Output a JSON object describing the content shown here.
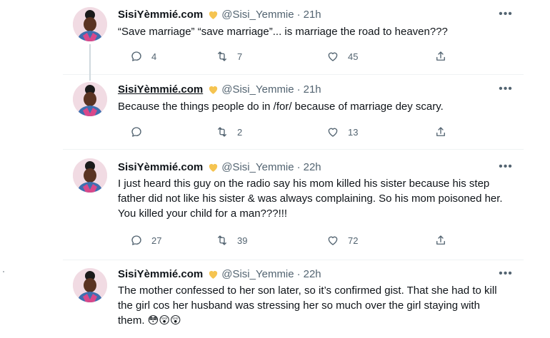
{
  "tweets": [
    {
      "name": "SisiYèmmié.com",
      "handle": "@Sisi_Yemmie",
      "sep": "·",
      "time": "21h",
      "text": "“Save marriage” “save marriage”... is marriage the road to heaven???",
      "replies": "4",
      "retweets": "7",
      "likes": "45"
    },
    {
      "name": "SisiYèmmié.com",
      "handle": "@Sisi_Yemmie",
      "sep": "·",
      "time": "21h",
      "text": "Because the things people do in /for/ because of marriage dey scary.",
      "replies": "",
      "retweets": "2",
      "likes": "13"
    },
    {
      "name": "SisiYèmmié.com",
      "handle": "@Sisi_Yemmie",
      "sep": "·",
      "time": "22h",
      "text": "I just heard this guy on the radio say his mom killed his sister because his step father did not like his sister & was always complaining. So his mom poisoned her. You killed your child for a man???!!!",
      "replies": "27",
      "retweets": "39",
      "likes": "72"
    },
    {
      "name": "SisiYèmmié.com",
      "handle": "@Sisi_Yemmie",
      "sep": "·",
      "time": "22h",
      "text": "The mother confessed to her son later, so it’s confirmed gist. That she had to kill the girl cos her husband was stressing her so much over the girl staying with them. 😳😲😲",
      "replies": "",
      "retweets": "",
      "likes": ""
    }
  ],
  "more_label": "•••",
  "colors": {
    "verified_heart": "#f5c451",
    "muted": "#536471",
    "thread_line": "#cfd9de"
  },
  "icons": {
    "reply": "reply-icon",
    "retweet": "retweet-icon",
    "like": "like-icon",
    "share": "share-icon",
    "verified": "yellow-heart-icon",
    "more": "more-icon"
  }
}
